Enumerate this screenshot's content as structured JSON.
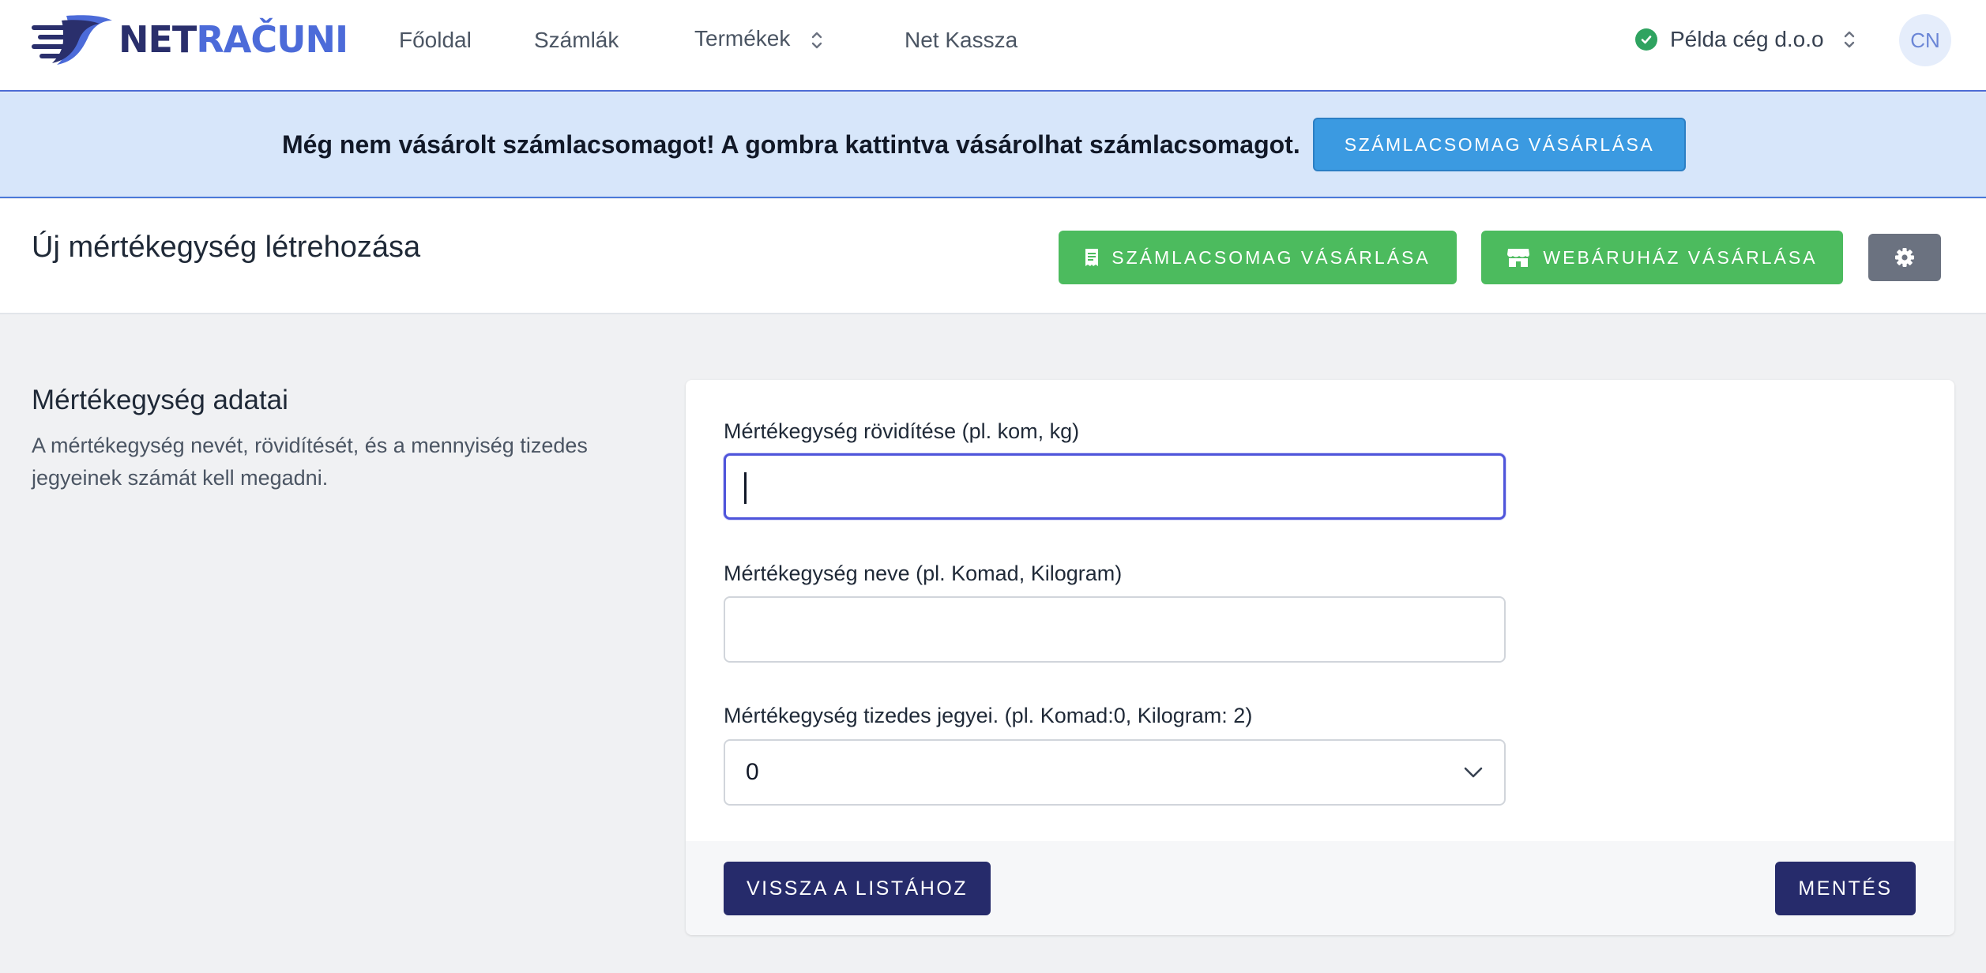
{
  "brand": {
    "name_part1": "NET",
    "name_part2": "RAČUNI"
  },
  "nav": {
    "items": [
      {
        "label": "Főoldal"
      },
      {
        "label": "Számlák"
      },
      {
        "label": "Termékek"
      },
      {
        "label": "Net Kassza"
      }
    ],
    "company": "Példa cég d.o.o",
    "avatar_initials": "CN"
  },
  "banner": {
    "message": "Még nem vásárolt számlacsomagot! A gombra kattintva vásárolhat számlacsomagot.",
    "button_label": "SZÁMLACSOMAG VÁSÁRLÁSA"
  },
  "header": {
    "title": "Új mértékegység létrehozása",
    "buy_invoice_label": "SZÁMLACSOMAG VÁSÁRLÁSA",
    "buy_shop_label": "WEBÁRUHÁZ VÁSÁRLÁSA"
  },
  "section": {
    "title": "Mértékegység adatai",
    "description": "A mértékegység nevét, rövidítését, és a mennyiség tizedes jegyeinek számát kell megadni."
  },
  "form": {
    "abbr_label": "Mértékegység rövidítése (pl. kom, kg)",
    "abbr_value": "",
    "name_label": "Mértékegység neve (pl. Komad, Kilogram)",
    "name_value": "",
    "decimals_label": "Mértékegység tizedes jegyei. (pl. Komad:0, Kilogram: 2)",
    "decimals_value": "0",
    "back_label": "VISSZA A LISTÁHOZ",
    "save_label": "MENTÉS"
  },
  "colors": {
    "brand_navy": "#2a2f6c",
    "brand_blue": "#4c6bd9",
    "banner_bg": "#d7e6fa",
    "info_button": "#3b9ae1",
    "success_button": "#4cbb5e",
    "primary_button": "#262b6b",
    "settings_button": "#6b7280",
    "focus_ring": "#4f55db"
  },
  "icons": {
    "logo": "speed-logo-icon",
    "chevrons": "chevron-up-down-icon",
    "company_status": "check-circle-icon",
    "invoice": "receipt-icon",
    "shop": "store-icon",
    "settings": "gear-icon",
    "select": "chevron-down-icon"
  }
}
